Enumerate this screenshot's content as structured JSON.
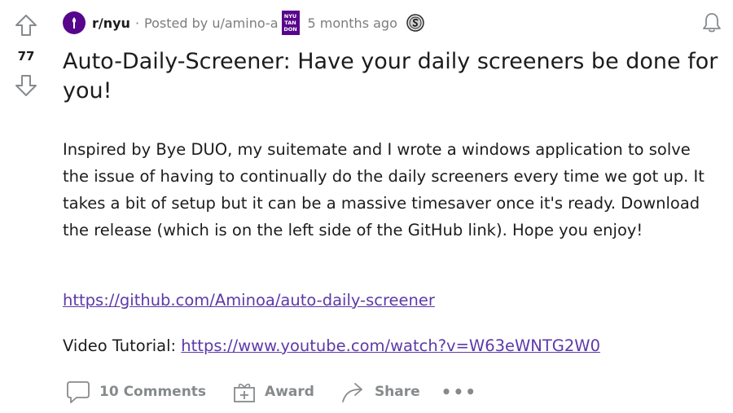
{
  "vote": {
    "count": "77"
  },
  "meta": {
    "subreddit": "r/nyu",
    "dot": "·",
    "posted_by": "Posted by u/amino-a",
    "flair_lines": [
      "NYU",
      "TAN",
      "DON"
    ],
    "age": "5 months ago"
  },
  "post": {
    "title": "Auto-Daily-Screener: Have your daily screeners be done for you!",
    "body": "Inspired by Bye DUO, my suitemate and I wrote a windows application to solve the issue of having to continually do the daily screeners every time we got up. It takes a bit of setup but it can be a massive timesaver once it's ready. Download the release (which is on the left side of the GitHub link). Hope you enjoy!",
    "github_link": "https://github.com/Aminoa/auto-daily-screener",
    "video_prefix": "Video Tutorial: ",
    "video_link": "https://www.youtube.com/watch?v=W63eWNTG2W0"
  },
  "actions": {
    "comments": "10 Comments",
    "award": "Award",
    "share": "Share",
    "more": "•••"
  },
  "icons": {
    "upvote": "upvote-arrow-icon",
    "downvote": "downvote-arrow-icon",
    "bell": "bell-icon",
    "comment": "comment-bubble-icon",
    "award": "gift-icon",
    "share": "share-arrow-icon",
    "award_badge": "silver-award-icon"
  },
  "colors": {
    "link": "#5d39a8",
    "nyu_purple": "#57068c",
    "muted": "#878a8c"
  }
}
